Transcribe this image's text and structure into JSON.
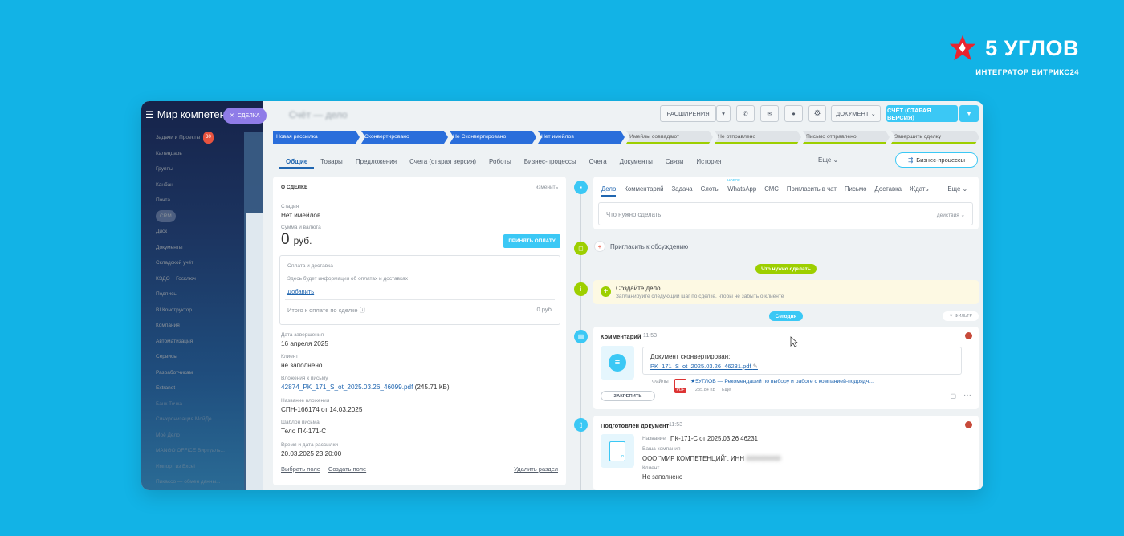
{
  "brand": {
    "name": "5 УГЛОВ",
    "subtitle": "ИНТЕГРАТОР БИТРИКС24",
    "logo_icon": "red-star-icon",
    "logo_color": "#e8242f"
  },
  "sidebar": {
    "title": "Мир компетенций",
    "deal_chip": "СДЕЛКА",
    "items": [
      {
        "label": "Задачи и Проекты",
        "badge": "30"
      },
      {
        "label": "Календарь"
      },
      {
        "label": "Группы"
      },
      {
        "label": "Канбан"
      },
      {
        "label": "Почта"
      },
      {
        "label": "CRM"
      },
      {
        "label": "Диск"
      },
      {
        "label": "Документы"
      },
      {
        "label": "Складской учёт"
      },
      {
        "label": "КЭДО + Госключ"
      },
      {
        "label": "Подпись"
      },
      {
        "label": "BI Конструктор"
      },
      {
        "label": "Компания"
      },
      {
        "label": "Автоматизация"
      },
      {
        "label": "Сервисы"
      },
      {
        "label": "Разработчикам"
      },
      {
        "label": "Extranet"
      },
      {
        "label": "Банк Точка"
      },
      {
        "label": "Синхронизация МойДе..."
      },
      {
        "label": "Моё Дело"
      },
      {
        "label": "MANGO OFFICE Виртуаль..."
      },
      {
        "label": "Импорт из Excel"
      },
      {
        "label": "Пикассо — обмен данны..."
      }
    ]
  },
  "toolbar": {
    "page_title": "Счёт — дело",
    "extensions_label": "РАСШИРЕНИЯ",
    "document_label": "ДОКУМЕНТ",
    "invoice_label": "СЧЁТ (СТАРАЯ ВЕРСИЯ)",
    "accent_color": "#3bc8f5"
  },
  "stages": [
    {
      "label": "Новая рассылка",
      "active": true
    },
    {
      "label": "Сконвертировано",
      "active": true
    },
    {
      "label": "Не Сконвертировано",
      "active": true
    },
    {
      "label": "Нет имейлов",
      "active": true
    },
    {
      "label": "Имейлы совпадают",
      "active": false
    },
    {
      "label": "Не отправлено",
      "active": false
    },
    {
      "label": "Письмо отправлено",
      "active": false
    },
    {
      "label": "Завершить сделку",
      "active": false
    }
  ],
  "tabs": [
    "Общие",
    "Товары",
    "Предложения",
    "Счета (старая версия)",
    "Роботы",
    "Бизнес-процессы",
    "Счета",
    "Документы",
    "Связи",
    "История"
  ],
  "tabs_more": "Еще",
  "bp_button": "Бизнес-процессы",
  "about": {
    "header": "О СДЕЛКЕ",
    "edit": "изменить",
    "stage_label": "Стадия",
    "stage_value": "Нет имейлов",
    "sum_label": "Сумма и валюта",
    "sum_value": "0",
    "currency": "руб.",
    "pay_button": "ПРИНЯТЬ ОПЛАТУ",
    "payment_title": "Оплата и доставка",
    "payment_hint": "Здесь будет информация об оплатах и доставках",
    "add": "Добавить",
    "total_label": "Итого к оплате по сделке",
    "total_value": "0 руб.",
    "close_date_label": "Дата завершения",
    "close_date": "16 апреля 2025",
    "client_label": "Клиент",
    "client_value": "не заполнено",
    "attach_label": "Вложения к письму",
    "attach_value": "42874_PK_171_S_ot_2025.03.26_46099.pdf",
    "attach_size": "(245.71 КБ)",
    "attach_name_label": "Название вложения",
    "attach_name": "СПН-166174 от 14.03.2025",
    "template_label": "Шаблон письма",
    "template_value": "Тело ПК-171-С",
    "send_time_label": "Время и дата рассылки",
    "send_time": "20.03.2025 23:20:00",
    "select_field": "Выбрать поле",
    "create_field": "Создать поле",
    "delete_section": "Удалить раздел"
  },
  "timeline": {
    "tabs": [
      "Дело",
      "Комментарий",
      "Задача",
      "Слоты",
      "WhatsApp",
      "СМС",
      "Пригласить в чат",
      "Письмо",
      "Доставка",
      "Ждать"
    ],
    "new_badge": "НОВОЕ",
    "more": "Еще",
    "todo_placeholder": "Что нужно сделать",
    "actions": "действия",
    "invite": "Пригласить к обсуждению",
    "todo_pill": "Что нужно сделать",
    "create_title": "Создайте дело",
    "create_hint": "Запланируйте следующий шаг по сделке, чтобы не забыть о клиенте",
    "today_pill": "Сегодня",
    "filter": "ФИЛЬТР",
    "comment": {
      "title": "Комментарий",
      "time": "11:53",
      "text": "Документ сконвертирован:",
      "link": "PK_171_S_ot_2025.03.26_46231.pdf",
      "files_label": "Файлы",
      "file_name": "★5УГЛОВ — Рекомендаций по выбору и работе с компанией-подрядч...",
      "file_size": "235.84 КБ",
      "file_more": "Ещё",
      "pin": "ЗАКРЕПИТЬ"
    },
    "document": {
      "title": "Подготовлен документ",
      "time": "11:53",
      "name_label": "Название",
      "name_value": "ПК-171-С от 2025.03.26 46231",
      "company_label": "Ваша компания",
      "company_value": "ООО \"МИР КОМПЕТЕНЦИЙ\", ИНН",
      "client_label": "Клиент",
      "client_value": "Не заполнено"
    }
  }
}
